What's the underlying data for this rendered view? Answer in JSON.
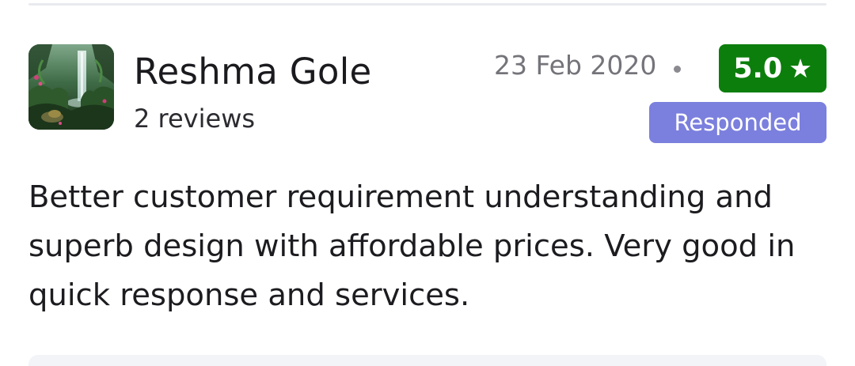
{
  "review": {
    "reviewer_name": "Reshma Gole",
    "review_count": "2 reviews",
    "date": "23 Feb 2020",
    "rating": "5.0",
    "rating_icon": "star-icon",
    "status": "Responded",
    "text": "Better customer requirement understanding and superb design with affordable prices. Very good in quick response and services."
  },
  "colors": {
    "rating_badge": "#0c7e0c",
    "status_badge": "#7b7fdd",
    "text_primary": "#1b1b1f",
    "text_muted": "#74747a"
  }
}
